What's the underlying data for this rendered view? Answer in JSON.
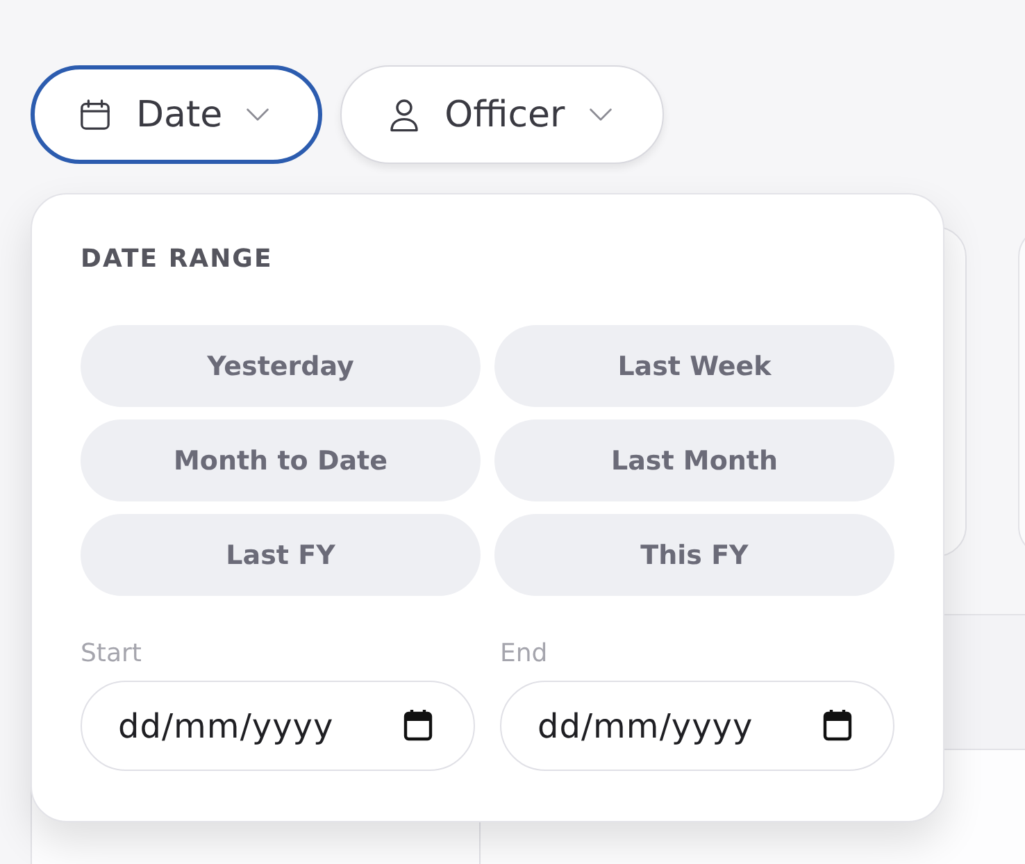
{
  "filters": [
    {
      "kind": "date",
      "label": "Date",
      "selected": true
    },
    {
      "kind": "person",
      "label": "Officer",
      "selected": false
    }
  ],
  "date_range_popover": {
    "title": "DATE RANGE",
    "presets": [
      "Yesterday",
      "Last Week",
      "Month to Date",
      "Last Month",
      "Last FY",
      "This FY"
    ],
    "fields": [
      {
        "label": "Start",
        "placeholder": "dd/mm/yyyy"
      },
      {
        "label": "End",
        "placeholder": "dd/mm/yyyy"
      }
    ]
  }
}
